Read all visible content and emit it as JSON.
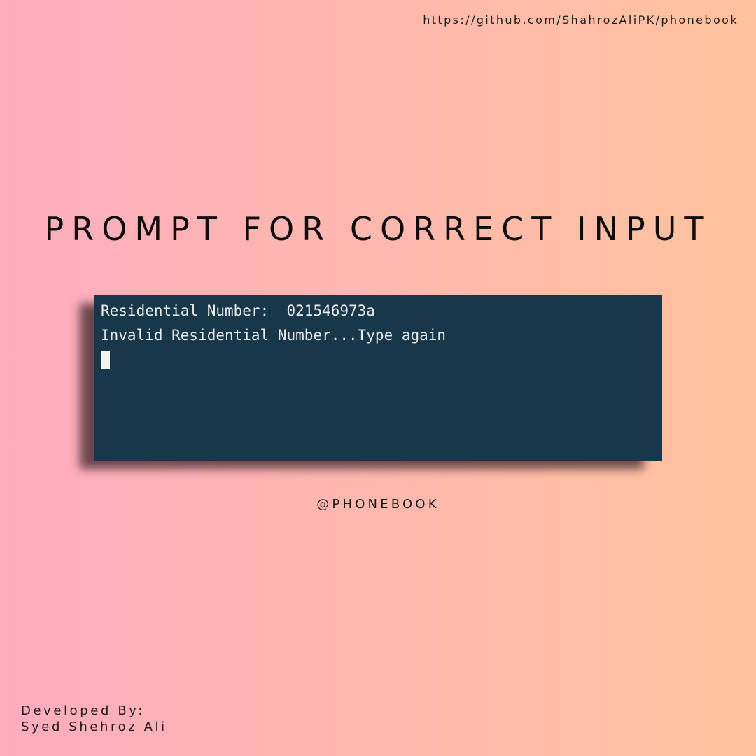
{
  "repo_url": "https://github.com/ShahrozAliPK/phonebook",
  "headline": "PROMPT FOR CORRECT INPUT",
  "terminal": {
    "prompt_label": "Residential Number:",
    "entered_value": "021546973a",
    "error_message": "Invalid Residential Number...Type again"
  },
  "handle": "@PHONEBOOK",
  "credits": {
    "line1": "Developed By:",
    "line2": "Syed Shehroz Ali"
  },
  "colors": {
    "background_gradient": [
      "#ffadbf",
      "#ffc39f"
    ],
    "terminal_background": "#18374b",
    "terminal_text": "#e8e8e8"
  }
}
